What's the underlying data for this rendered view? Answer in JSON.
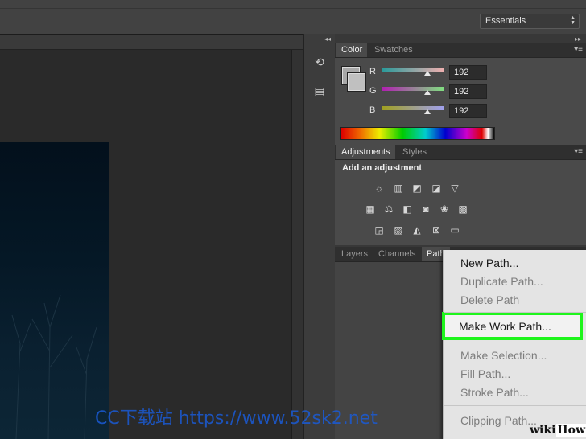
{
  "workspace": {
    "label": "Essentials"
  },
  "color_panel": {
    "tabs": [
      "Color",
      "Swatches"
    ],
    "channels": [
      {
        "label": "R",
        "value": "192",
        "gradient": [
          "#2a9a9a",
          "#f0b0b0"
        ]
      },
      {
        "label": "G",
        "value": "192",
        "gradient": [
          "#b020b0",
          "#80e080"
        ]
      },
      {
        "label": "B",
        "value": "192",
        "gradient": [
          "#a0a020",
          "#a0a0f0"
        ]
      }
    ]
  },
  "adjustments_panel": {
    "tabs": [
      "Adjustments",
      "Styles"
    ],
    "title": "Add an adjustment"
  },
  "layers_panel": {
    "tabs": [
      "Layers",
      "Channels",
      "Path"
    ]
  },
  "context_menu": {
    "items": [
      {
        "label": "New Path...",
        "enabled": true
      },
      {
        "label": "Duplicate Path...",
        "enabled": false
      },
      {
        "label": "Delete Path",
        "enabled": false
      },
      {
        "label": "Make Work Path...",
        "enabled": true,
        "highlighted": true
      },
      {
        "label": "Make Selection...",
        "enabled": false
      },
      {
        "label": "Fill Path...",
        "enabled": false
      },
      {
        "label": "Stroke Path...",
        "enabled": false
      },
      {
        "label": "Clipping Path...",
        "enabled": false
      }
    ]
  },
  "watermark": {
    "text": "CC下载站 https://www.52sk2.net"
  },
  "brand": {
    "wiki": "wiki",
    "how": "How"
  },
  "colors": {
    "highlight": "#1ef51c",
    "menu_bg": "#e4e4e4"
  }
}
